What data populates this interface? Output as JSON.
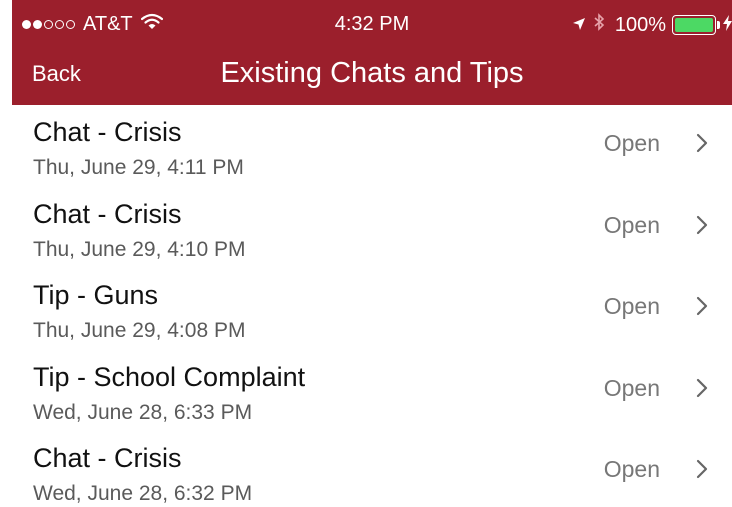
{
  "status_bar": {
    "carrier": "AT&T",
    "time": "4:32 PM",
    "battery": "100%",
    "signal_filled": 2,
    "signal_total": 5,
    "battery_level": 1.0
  },
  "nav": {
    "back_label": "Back",
    "title": "Existing Chats and Tips"
  },
  "items": [
    {
      "title": "Chat - Crisis",
      "date": "Thu, June 29, 4:11 PM",
      "action": "Open"
    },
    {
      "title": "Chat - Crisis",
      "date": "Thu, June 29, 4:10 PM",
      "action": "Open"
    },
    {
      "title": "Tip - Guns",
      "date": "Thu, June 29, 4:08 PM",
      "action": "Open"
    },
    {
      "title": "Tip - School Complaint",
      "date": "Wed, June 28, 6:33 PM",
      "action": "Open"
    },
    {
      "title": "Chat - Crisis",
      "date": "Wed, June 28, 6:32 PM",
      "action": "Open"
    }
  ],
  "colors": {
    "nav_background": "#9b1f2c",
    "battery_fill": "#4cd964"
  }
}
